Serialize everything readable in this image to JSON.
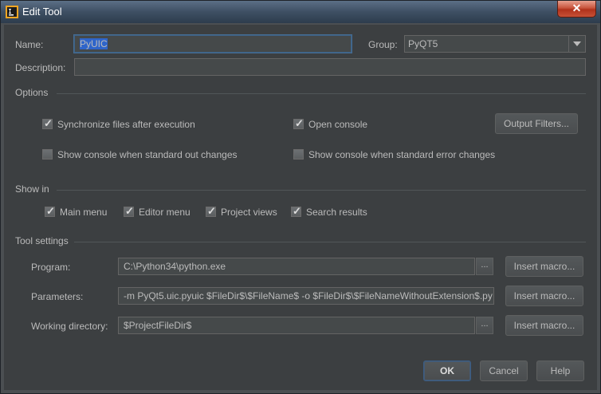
{
  "window": {
    "title": "Edit Tool",
    "close_label": "✕"
  },
  "name": {
    "label": "Name:",
    "value": "PyUIC"
  },
  "group": {
    "label": "Group:",
    "value": "PyQT5"
  },
  "description": {
    "label": "Description:",
    "value": ""
  },
  "options": {
    "heading": "Options",
    "sync_files": {
      "label": "Synchronize files after execution",
      "checked": true
    },
    "open_console": {
      "label": "Open console",
      "checked": true
    },
    "output_filters_button": "Output Filters...",
    "show_console_stdout": {
      "label": "Show console when standard out changes",
      "checked": false
    },
    "show_console_stderr": {
      "label": "Show console when standard error changes",
      "checked": false
    }
  },
  "show_in": {
    "heading": "Show in",
    "main_menu": "Main menu",
    "editor_menu": "Editor menu",
    "project_views": "Project views",
    "search_results": "Search results"
  },
  "tool_settings": {
    "heading": "Tool settings",
    "program": {
      "label": "Program:",
      "value": "C:\\Python34\\python.exe"
    },
    "parameters": {
      "label": "Parameters:",
      "value": "-m PyQt5.uic.pyuic  $FileDir$\\$FileName$ -o $FileDir$\\$FileNameWithoutExtension$.py"
    },
    "working_directory": {
      "label": "Working directory:",
      "value": "$ProjectFileDir$"
    },
    "browse_label": "...",
    "insert_macro_label": "Insert macro..."
  },
  "buttons": {
    "ok": "OK",
    "cancel": "Cancel",
    "help": "Help"
  },
  "colors": {
    "dialog_bg": "#3c3f41",
    "text": "#bbbbbb",
    "selection": "#2f65ca",
    "focus_border": "#466d94"
  }
}
